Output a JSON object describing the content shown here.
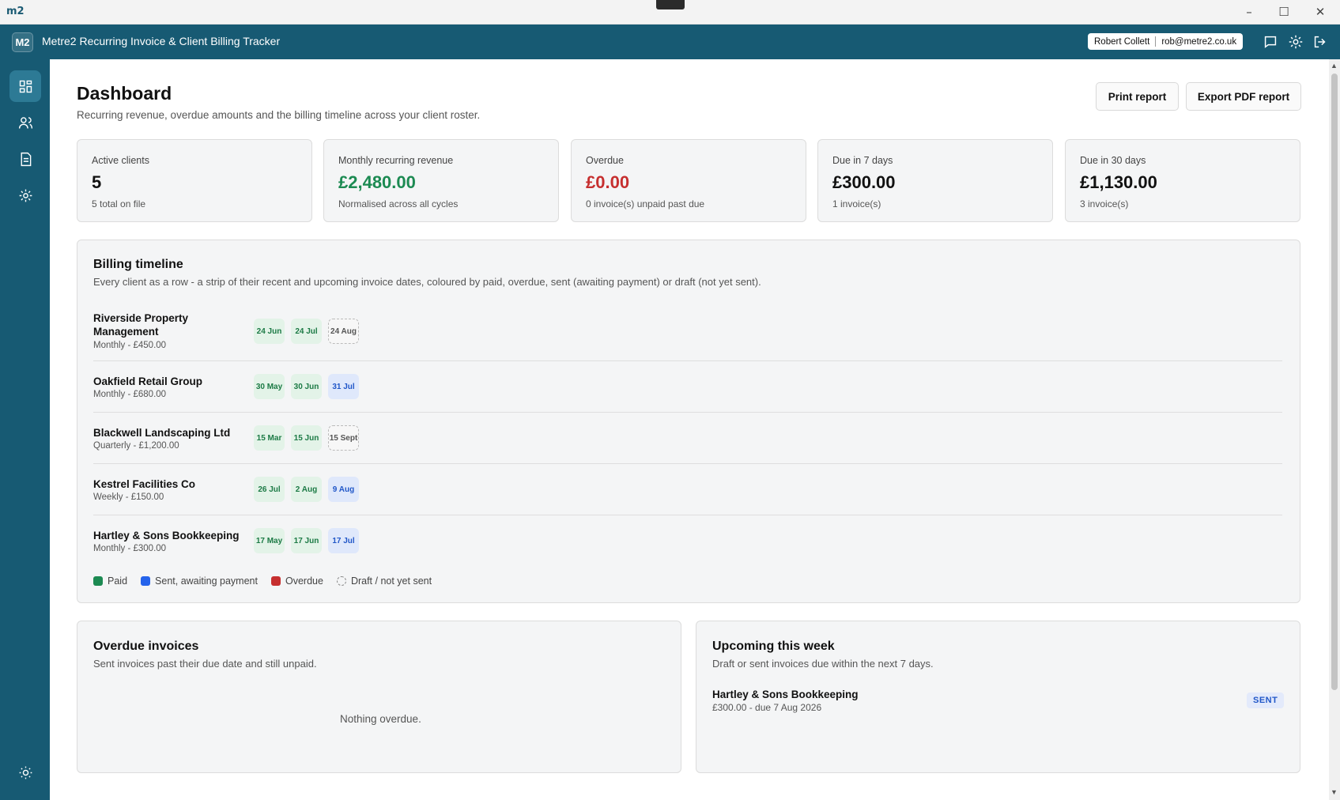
{
  "window": {
    "app_logo": "m2",
    "minimize": "–",
    "maximize": "☐",
    "close": "✕"
  },
  "header": {
    "logo": "M2",
    "title": "Metre2 Recurring Invoice & Client Billing Tracker",
    "user_name": "Robert Collett",
    "user_email": "rob@metre2.co.uk",
    "icons": [
      "chat-icon",
      "gear-icon",
      "logout-icon"
    ]
  },
  "sidebar": {
    "items": [
      {
        "name": "dashboard",
        "icon": "grid-icon",
        "active": true
      },
      {
        "name": "clients",
        "icon": "users-icon",
        "active": false
      },
      {
        "name": "invoices",
        "icon": "document-icon",
        "active": false
      },
      {
        "name": "settings",
        "icon": "gear-icon",
        "active": false
      }
    ],
    "footer_icon": "sun-icon"
  },
  "page": {
    "title": "Dashboard",
    "subtitle": "Recurring revenue, overdue amounts and the billing timeline across your client roster.",
    "print_label": "Print report",
    "export_label": "Export PDF report"
  },
  "stats": [
    {
      "label": "Active clients",
      "value": "5",
      "sub": "5 total on file"
    },
    {
      "label": "Monthly recurring revenue",
      "value": "£2,480.00",
      "sub": "Normalised across all cycles",
      "color": "#1c8a52"
    },
    {
      "label": "Overdue",
      "value": "£0.00",
      "sub": "0 invoice(s) unpaid past due",
      "color": "#c62f2f"
    },
    {
      "label": "Due in 7 days",
      "value": "£300.00",
      "sub": "1 invoice(s)"
    },
    {
      "label": "Due in 30 days",
      "value": "£1,130.00",
      "sub": "3 invoice(s)"
    }
  ],
  "timeline": {
    "title": "Billing timeline",
    "subtitle": "Every client as a row - a strip of their recent and upcoming invoice dates, coloured by paid, overdue, sent (awaiting payment) or draft (not yet sent).",
    "rows": [
      {
        "name": "Riverside Property Management",
        "cycle": "Monthly - £450.00",
        "chips": [
          {
            "date": "24 Jun",
            "status": "paid"
          },
          {
            "date": "24 Jul",
            "status": "paid"
          },
          {
            "date": "24 Aug",
            "status": "draft"
          }
        ]
      },
      {
        "name": "Oakfield Retail Group",
        "cycle": "Monthly - £680.00",
        "chips": [
          {
            "date": "30 May",
            "status": "paid"
          },
          {
            "date": "30 Jun",
            "status": "paid"
          },
          {
            "date": "31 Jul",
            "status": "sent"
          }
        ]
      },
      {
        "name": "Blackwell Landscaping Ltd",
        "cycle": "Quarterly - £1,200.00",
        "chips": [
          {
            "date": "15 Mar",
            "status": "paid"
          },
          {
            "date": "15 Jun",
            "status": "paid"
          },
          {
            "date": "15 Sept",
            "status": "draft"
          }
        ]
      },
      {
        "name": "Kestrel Facilities Co",
        "cycle": "Weekly - £150.00",
        "chips": [
          {
            "date": "26 Jul",
            "status": "paid"
          },
          {
            "date": "2 Aug",
            "status": "paid"
          },
          {
            "date": "9 Aug",
            "status": "sent"
          }
        ]
      },
      {
        "name": "Hartley & Sons Bookkeeping",
        "cycle": "Monthly - £300.00",
        "chips": [
          {
            "date": "17 May",
            "status": "paid"
          },
          {
            "date": "17 Jun",
            "status": "paid"
          },
          {
            "date": "17 Jul",
            "status": "sent"
          }
        ]
      }
    ],
    "legend": [
      {
        "label": "Paid",
        "color": "#1c8a52"
      },
      {
        "label": "Sent, awaiting payment",
        "color": "#2563eb"
      },
      {
        "label": "Overdue",
        "color": "#c62f2f"
      },
      {
        "label": "Draft / not yet sent",
        "color": "dashed"
      }
    ]
  },
  "overdue": {
    "title": "Overdue invoices",
    "subtitle": "Sent invoices past their due date and still unpaid.",
    "empty": "Nothing overdue."
  },
  "upcoming": {
    "title": "Upcoming this week",
    "subtitle": "Draft or sent invoices due within the next 7 days.",
    "items": [
      {
        "client": "Hartley & Sons Bookkeeping",
        "meta": "£300.00 - due 7 Aug 2026",
        "status": "SENT"
      }
    ]
  }
}
